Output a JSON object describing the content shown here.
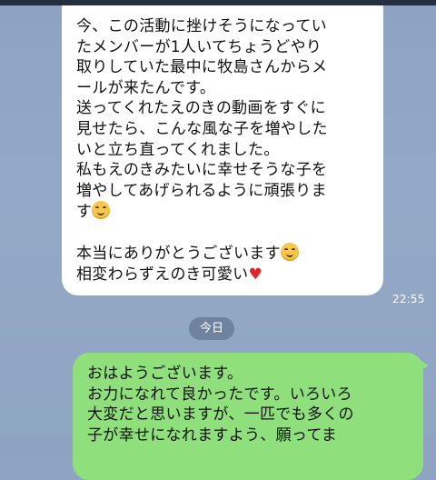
{
  "chat": {
    "incoming_message": {
      "para1_lines": [
        "今、この活動に挫けそうになってい",
        "たメンバーが1人いてちょうどやり",
        "取りしていた最中に牧島さんからメ",
        "ールが来たんです。",
        "送ってくれたえのきの動画をすぐに",
        "見せたら、こんな風な子を増やした",
        "いと立ち直ってくれました。",
        "私もえのきみたいに幸せそうな子を",
        "増やしてあげられるように頑張りま",
        "す"
      ],
      "para2_line1": "本当にありがとうございます",
      "para2_line2": "相変わらずえのき可愛い",
      "emoji_names": [
        "smiling-face-icon",
        "smiling-face-icon",
        "red-heart-icon"
      ]
    },
    "incoming_time": "22:55",
    "date_divider": "今日",
    "outgoing_message": {
      "lines": [
        "おはようございます。",
        "お力になれて良かったです。いろいろ",
        "大変だと思いますが、一匹でも多くの",
        "子が幸せになれますよう、願ってま"
      ]
    }
  }
}
